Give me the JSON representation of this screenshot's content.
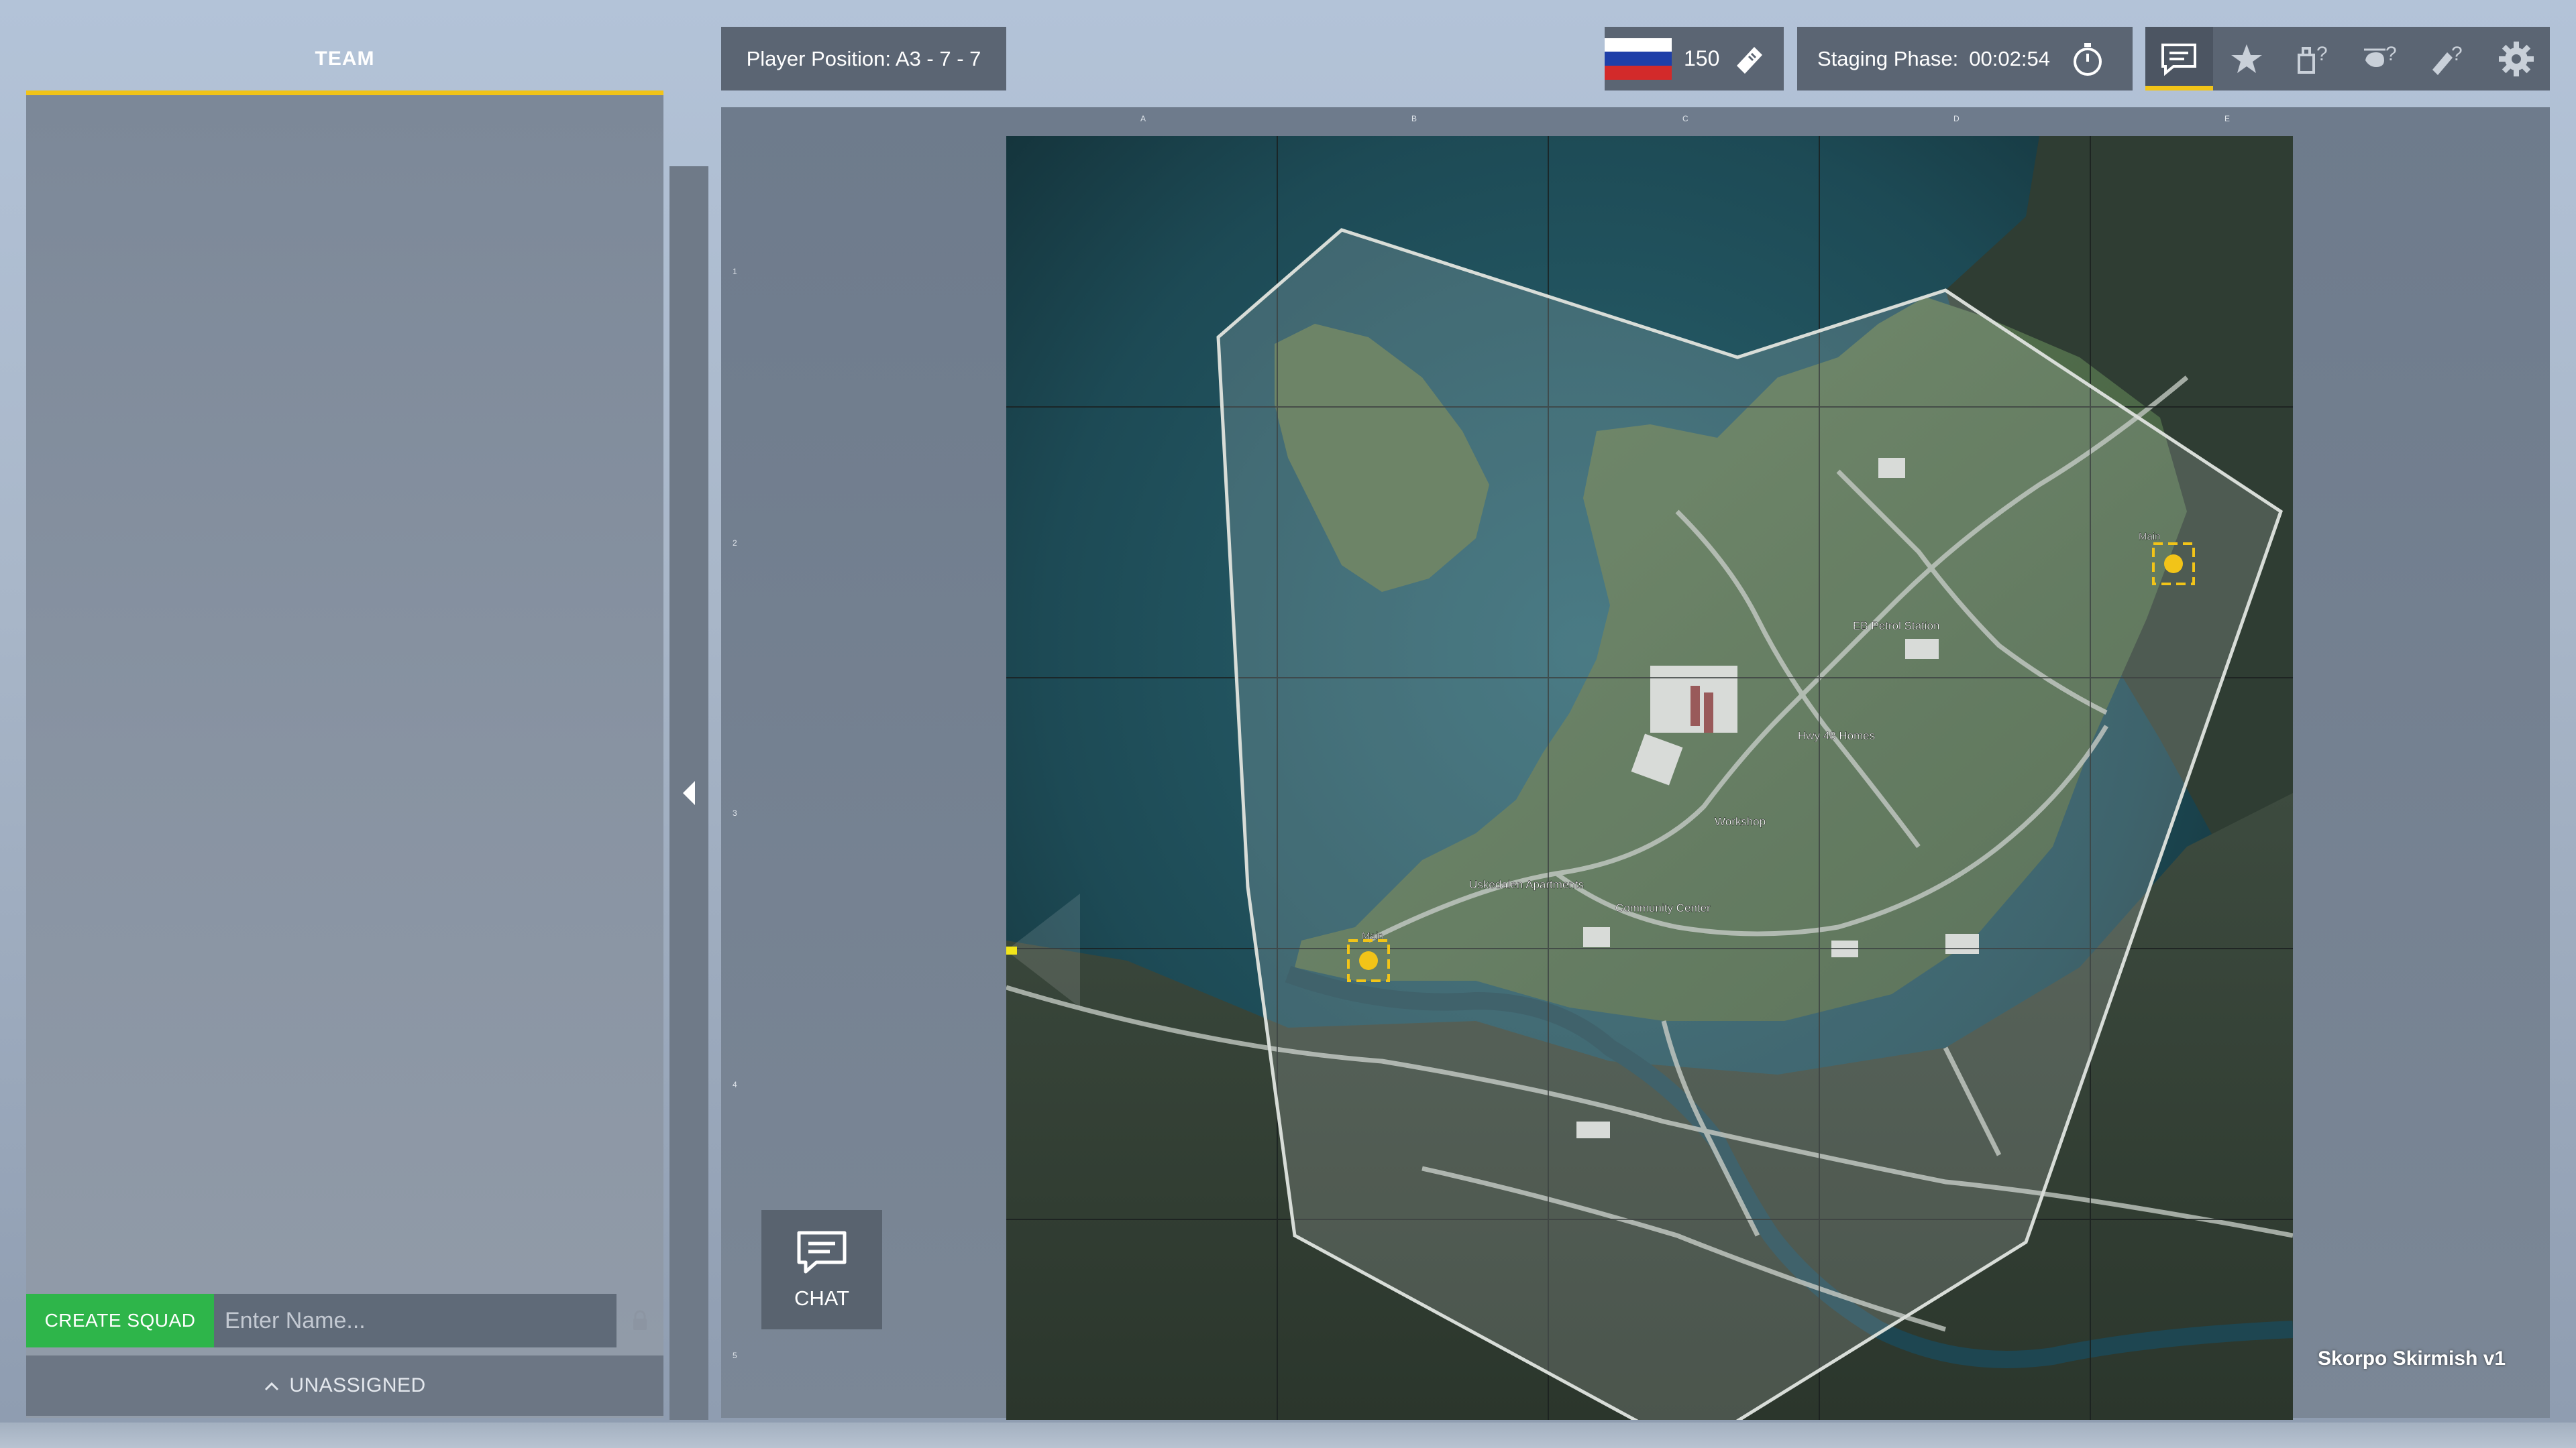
{
  "team_panel": {
    "title": "TEAM",
    "create_squad_label": "CREATE SQUAD",
    "name_placeholder": "Enter Name...",
    "unassigned_label": "UNASSIGNED"
  },
  "top_bar": {
    "player_position": "Player Position: A3 - 7 - 7",
    "team_flag": "russia-flag-icon",
    "tickets": "150",
    "staging_label": "Staging Phase:",
    "staging_time": "00:02:54",
    "toolbar_icons": [
      "chat-icon",
      "favorite-star-icon",
      "vehicle-help-icon",
      "helicopter-help-icon",
      "deployable-help-icon",
      "settings-gear-icon"
    ]
  },
  "map": {
    "name": "Skorpo Skirmish v1",
    "grid_columns": [
      "A",
      "B",
      "C",
      "D",
      "E"
    ],
    "grid_rows": [
      "1",
      "2",
      "3",
      "4",
      "5"
    ],
    "locations": {
      "petrol_station": "EB Petrol Station",
      "hwy_homes": "Hwy 48 Homes",
      "workshop": "Workshop",
      "apartments": "Uskedalen Apartments",
      "community_center": "Community Center",
      "main_west": "Main",
      "main_east": "Main"
    }
  },
  "chat_button": {
    "label": "CHAT"
  },
  "colors": {
    "accent": "#f2c418",
    "create_squad": "#2eb54a",
    "panel": "#5b6573",
    "water": "#1f4a55",
    "land": "#4e6b4a"
  }
}
